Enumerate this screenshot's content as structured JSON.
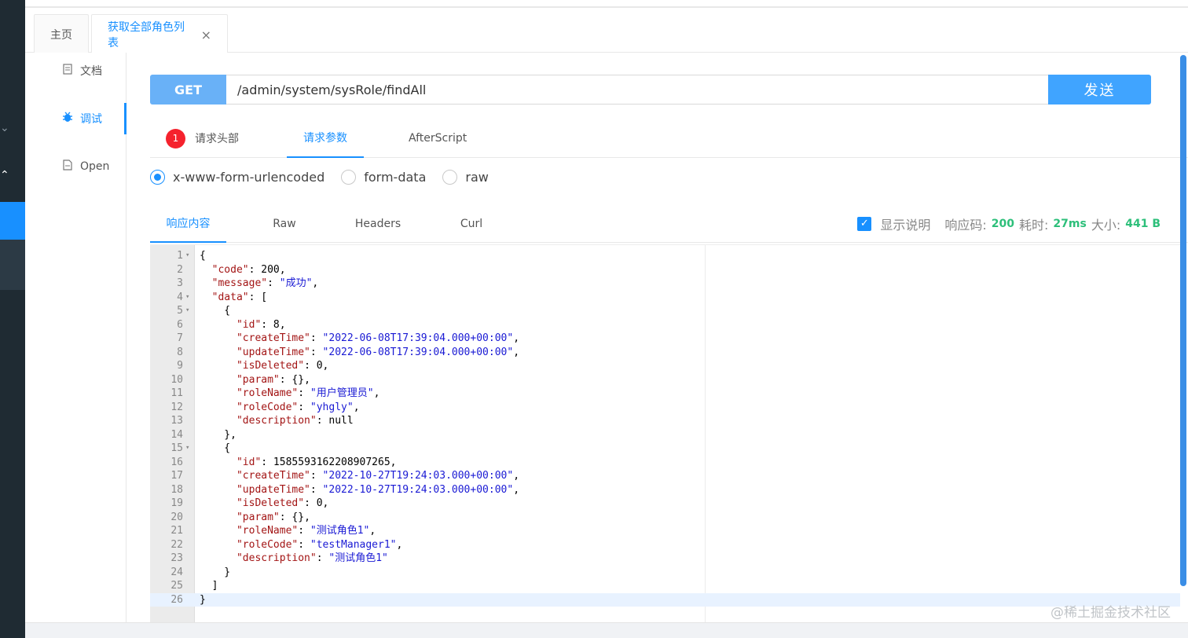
{
  "tabs": {
    "home": "主页",
    "current": "获取全部角色列表",
    "close": "×"
  },
  "doc_menu": [
    {
      "icon": "document-icon",
      "label": "文档"
    },
    {
      "icon": "bug-icon",
      "label": "调试"
    },
    {
      "icon": "file-icon",
      "label": "Open"
    }
  ],
  "request": {
    "method": "GET",
    "url": "/admin/system/sysRole/findAll",
    "send_label": "发送"
  },
  "request_tabs": {
    "header_badge": "1",
    "headers": "请求头部",
    "params": "请求参数",
    "afterscript": "AfterScript"
  },
  "body_types": [
    {
      "label": "x-www-form-urlencoded",
      "selected": true
    },
    {
      "label": "form-data",
      "selected": false
    },
    {
      "label": "raw",
      "selected": false
    }
  ],
  "response_tabs": {
    "content": "响应内容",
    "raw": "Raw",
    "headers": "Headers",
    "curl": "Curl"
  },
  "response_meta": {
    "show_desc": "显示说明",
    "code_label": "响应码:",
    "code": "200",
    "time_label": "耗时:",
    "time": "27ms",
    "size_label": "大小:",
    "size": "441 B"
  },
  "code_lines": [
    "{",
    "  \"code\": 200,",
    "  \"message\": \"成功\",",
    "  \"data\": [",
    "    {",
    "      \"id\": 8,",
    "      \"createTime\": \"2022-06-08T17:39:04.000+00:00\",",
    "      \"updateTime\": \"2022-06-08T17:39:04.000+00:00\",",
    "      \"isDeleted\": 0,",
    "      \"param\": {},",
    "      \"roleName\": \"用户管理员\",",
    "      \"roleCode\": \"yhgly\",",
    "      \"description\": null",
    "    },",
    "    {",
    "      \"id\": 1585593162208907265,",
    "      \"createTime\": \"2022-10-27T19:24:03.000+00:00\",",
    "      \"updateTime\": \"2022-10-27T19:24:03.000+00:00\",",
    "      \"isDeleted\": 0,",
    "      \"param\": {},",
    "      \"roleName\": \"测试角色1\",",
    "      \"roleCode\": \"testManager1\",",
    "      \"description\": \"测试角色1\"",
    "    }",
    "  ]",
    "}"
  ],
  "fold_lines": [
    1,
    4,
    5,
    15
  ],
  "active_line": 26,
  "watermark": "@稀土掘金技术社区",
  "colors": {
    "accent": "#1890ff",
    "method_bg": "#69b1f7",
    "send_bg": "#40a4ff",
    "success": "#2dbf7a"
  }
}
